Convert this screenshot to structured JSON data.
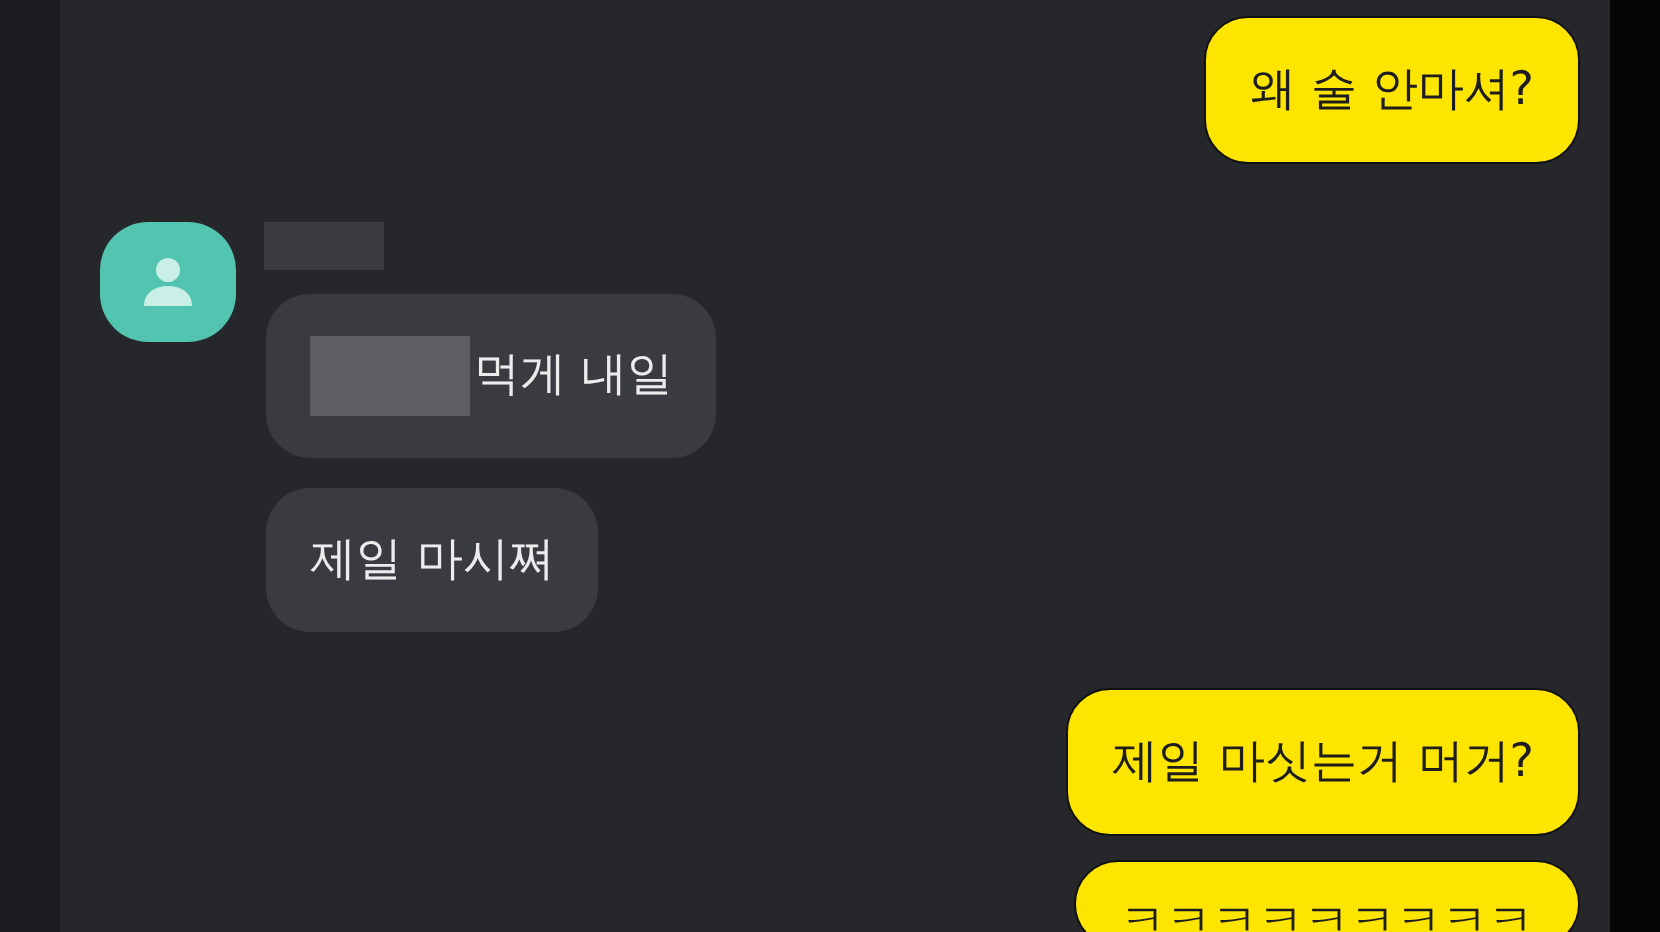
{
  "messages": [
    {
      "kind": "outgoing",
      "text": "왜 술 안마셔?"
    },
    {
      "kind": "incoming",
      "show_avatar": true,
      "redacted_prefix": true,
      "text": "먹게 내일"
    },
    {
      "kind": "incoming",
      "text": "제일 마시쪄"
    },
    {
      "kind": "outgoing",
      "text": "제일 마싯는거 머거?"
    },
    {
      "kind": "outgoing",
      "text": "ㅋㅋㅋㅋㅋㅋㅋㅋㅋ"
    }
  ]
}
